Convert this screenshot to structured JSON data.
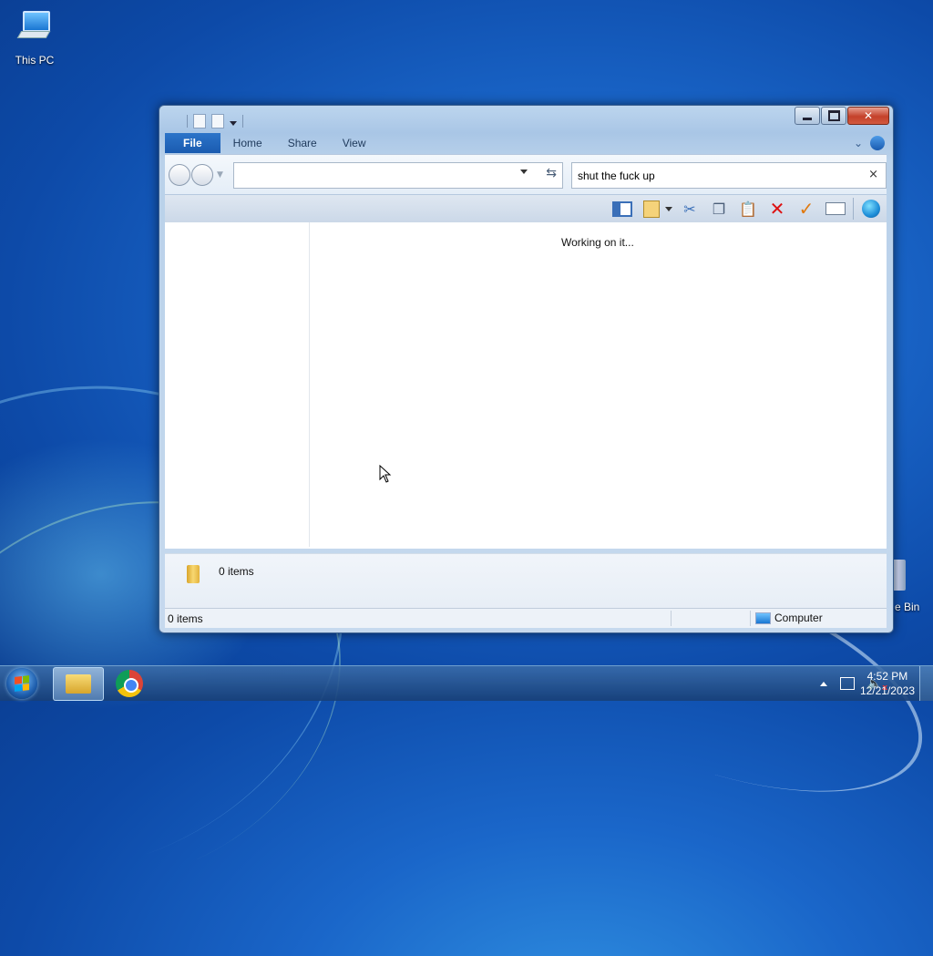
{
  "desktop": {
    "icons": [
      {
        "label": "This PC"
      },
      {
        "label": "e Bin"
      }
    ]
  },
  "window": {
    "tabs": {
      "file": "File",
      "home": "Home",
      "share": "Share",
      "view": "View"
    },
    "help_label": "?",
    "controls": {
      "close": "✕"
    },
    "address": {
      "value": ""
    },
    "search": {
      "value": "shut the fuck up",
      "clear": "×"
    },
    "content": {
      "message": "Working on it..."
    },
    "details": {
      "count": "0 items"
    },
    "status": {
      "items": "0 items",
      "location": "Computer"
    }
  },
  "toolbar_icons": [
    "pane-icon",
    "new-folder-icon",
    "cut-icon",
    "copy-icon",
    "paste-icon",
    "delete-icon",
    "check-icon",
    "rename-icon",
    "globe-icon"
  ],
  "taskbar": {
    "clock": {
      "time": "4:52 PM",
      "date": "12/21/2023"
    }
  },
  "colors": {
    "file_tab": "#1a5bb0",
    "close_button": "#c4402a",
    "delete_icon": "#dd1111",
    "check_icon": "#e07a10"
  }
}
